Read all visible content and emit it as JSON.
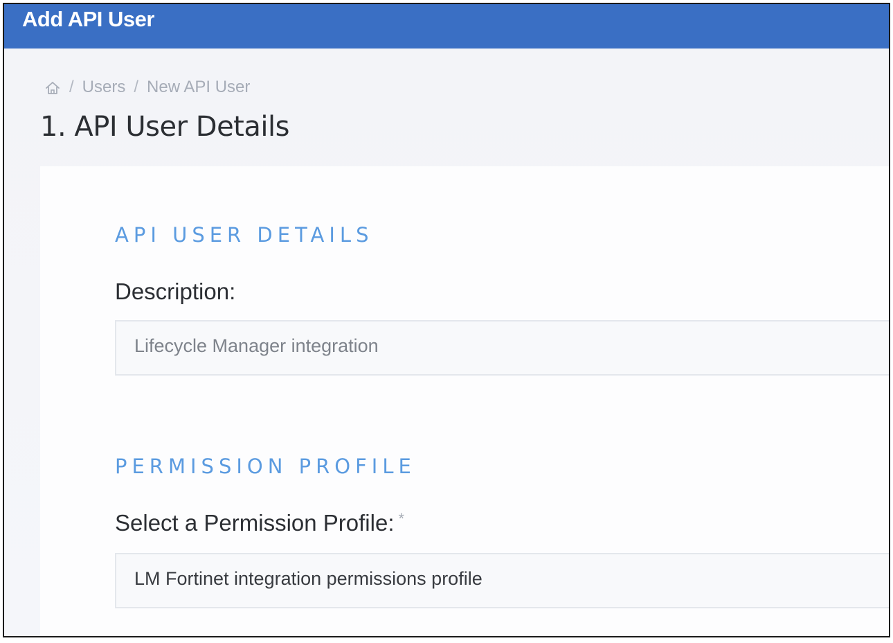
{
  "window": {
    "title": "Add API User"
  },
  "breadcrumb": {
    "home_icon": "home-icon",
    "items": [
      "Users",
      "New API User"
    ],
    "separator": "/"
  },
  "page": {
    "title": "1. API User Details"
  },
  "sections": {
    "details": {
      "heading": "API USER DETAILS",
      "description_label": "Description:",
      "description_placeholder": "Lifecycle Manager integration"
    },
    "permission": {
      "heading": "PERMISSION PROFILE",
      "select_label": "Select a Permission Profile:",
      "required_marker": "*",
      "selected_value": "LM Fortinet integration permissions profile"
    }
  },
  "colors": {
    "titlebar": "#3a6fc4",
    "section_heading": "#5b9be0",
    "background": "#f4f5f9",
    "card": "#fdfdfe"
  }
}
